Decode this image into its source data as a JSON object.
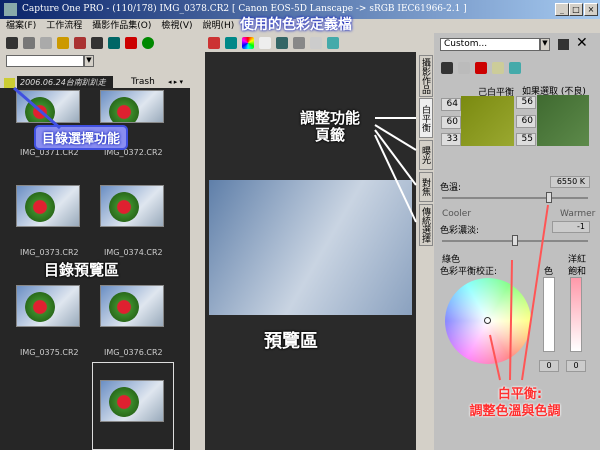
{
  "window": {
    "title": "Capture One PRO  -  (110/178) IMG_0378.CR2  [ Canon EOS-5D Lanscape -> sRGB IEC61966-2.1 ]",
    "min": "_",
    "max": "□",
    "close": "×"
  },
  "menu": [
    "檔案(F)",
    "工作流程",
    "攝影作品集(O)",
    "檢視(V)",
    "說明(H)"
  ],
  "annotations": {
    "profile": "使用的色彩定義檔",
    "folder_select": "目錄選擇功能",
    "folder_preview": "目錄預覽區",
    "preview": "預覽區",
    "tabs": "調整功能\n頁籤",
    "wb_line1": "白平衡:",
    "wb_line2": "調整色溫與色調"
  },
  "folder_tabs": [
    "2006.06.24台南趴趴走",
    "Trash"
  ],
  "thumbnails": [
    "IMG_0371.CR2",
    "IMG_0372.CR2",
    "IMG_0373.CR2",
    "IMG_0374.CR2",
    "IMG_0375.CR2",
    "IMG_0376.CR2"
  ],
  "side_tabs": [
    "攝影作品",
    "白平衡",
    "曝光",
    "對焦",
    "傳統選擇"
  ],
  "right": {
    "preset": "Custom...",
    "wb_label": "己白平衡",
    "bad_label": "如果選取 (不良)",
    "wb_rgb": [
      "64",
      "60",
      "33"
    ],
    "bad_rgb": [
      "56",
      "60",
      "55"
    ],
    "temp_label": "色溫:",
    "temp_value": "6550 K",
    "temp_fraction": 0.73,
    "cooler": "Cooler",
    "warmer": "Warmer",
    "tint_label": "色彩濃淡:",
    "tint_value": "-1",
    "tint_fraction": 0.5,
    "green": "綠色",
    "magenta": "洋紅",
    "cb_label": "色彩平衡校正:",
    "hue": "色",
    "sat": "飽和",
    "hue_value": "0",
    "sat_value": "0"
  }
}
